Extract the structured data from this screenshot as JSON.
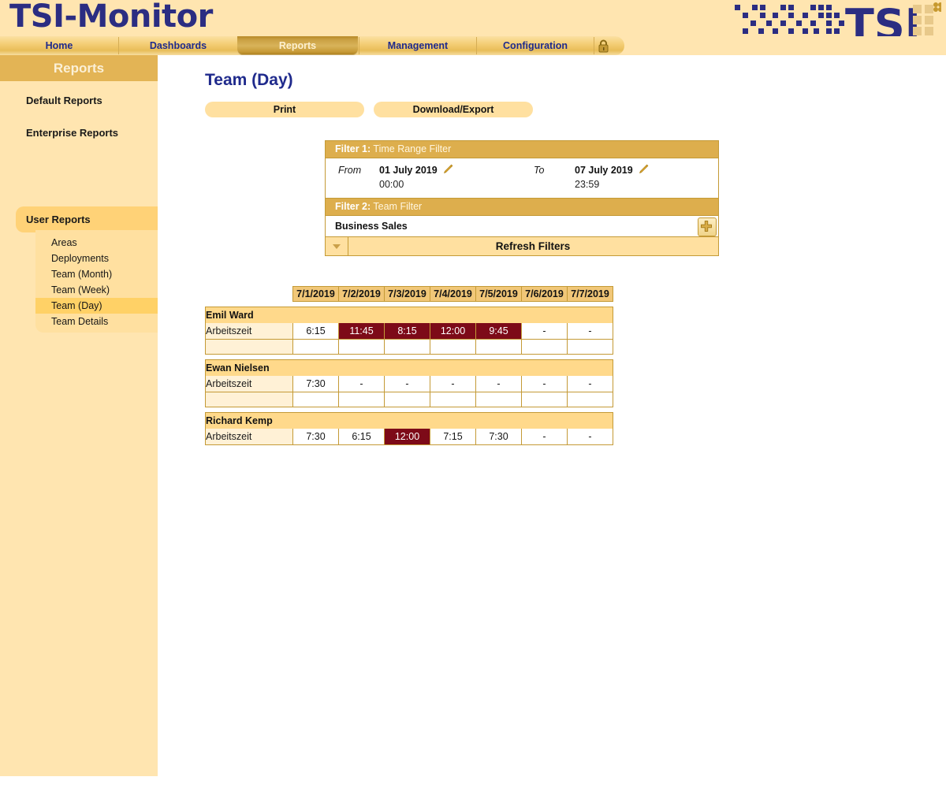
{
  "app": {
    "brand": "TSI-Monitor",
    "logo_text": "TSI"
  },
  "nav": {
    "tabs": [
      {
        "label": "Home",
        "active": false
      },
      {
        "label": "Dashboards",
        "active": false
      },
      {
        "label": "Reports",
        "active": true
      },
      {
        "label": "Management",
        "active": false
      },
      {
        "label": "Configuration",
        "active": false
      }
    ],
    "lock_icon": "lock-icon"
  },
  "sidebar": {
    "title": "Reports",
    "links": [
      {
        "label": "Default Reports"
      },
      {
        "label": "Enterprise Reports"
      }
    ],
    "active_group": "User Reports",
    "sub_items": [
      {
        "label": "Areas",
        "selected": false
      },
      {
        "label": "Deployments",
        "selected": false
      },
      {
        "label": "Team (Month)",
        "selected": false
      },
      {
        "label": "Team (Week)",
        "selected": false
      },
      {
        "label": "Team (Day)",
        "selected": true
      },
      {
        "label": "Team Details",
        "selected": false
      }
    ]
  },
  "main": {
    "page_title": "Team (Day)",
    "buttons": {
      "print": "Print",
      "export": "Download/Export"
    }
  },
  "filters": {
    "filter1": {
      "prefix": "Filter 1:",
      "name": " Time Range Filter",
      "from_label": "From",
      "from_date": "01 July 2019",
      "from_time": "00:00",
      "to_label": "To",
      "to_date": "07 July 2019",
      "to_time": "23:59",
      "edit_icon": "pencil-icon"
    },
    "filter2": {
      "prefix": "Filter 2:",
      "name": " Team Filter",
      "value": "Business Sales",
      "add_icon": "plus-icon"
    },
    "refresh": {
      "label": "Refresh Filters",
      "collapse_icon": "chevron-down-icon"
    }
  },
  "table": {
    "columns": [
      "7/1/2019",
      "7/2/2019",
      "7/3/2019",
      "7/4/2019",
      "7/5/2019",
      "7/6/2019",
      "7/7/2019"
    ],
    "groups": [
      {
        "name": "Emil Ward",
        "row_label": "Arbeitszeit",
        "values": [
          "6:15",
          "11:45",
          "8:15",
          "12:00",
          "9:45",
          "-",
          "-"
        ],
        "highlight": [
          false,
          true,
          true,
          true,
          true,
          false,
          false
        ]
      },
      {
        "name": "Ewan Nielsen",
        "row_label": "Arbeitszeit",
        "values": [
          "7:30",
          "-",
          "-",
          "-",
          "-",
          "-",
          "-"
        ],
        "highlight": [
          false,
          false,
          false,
          false,
          false,
          false,
          false
        ]
      },
      {
        "name": "Richard Kemp",
        "row_label": "Arbeitszeit",
        "values": [
          "7:30",
          "6:15",
          "12:00",
          "7:15",
          "7:30",
          "-",
          "-"
        ],
        "highlight": [
          false,
          false,
          true,
          false,
          false,
          false,
          false
        ]
      }
    ]
  },
  "colors": {
    "header_bg": "#ffe5b0",
    "nav_active": "#c79a36",
    "brand": "#2b2d82",
    "sidebar_bg": "#ffe5b0",
    "filter_header": "#ddae4d",
    "highlight_cell": "#7d0a18",
    "border": "#c49a36"
  }
}
